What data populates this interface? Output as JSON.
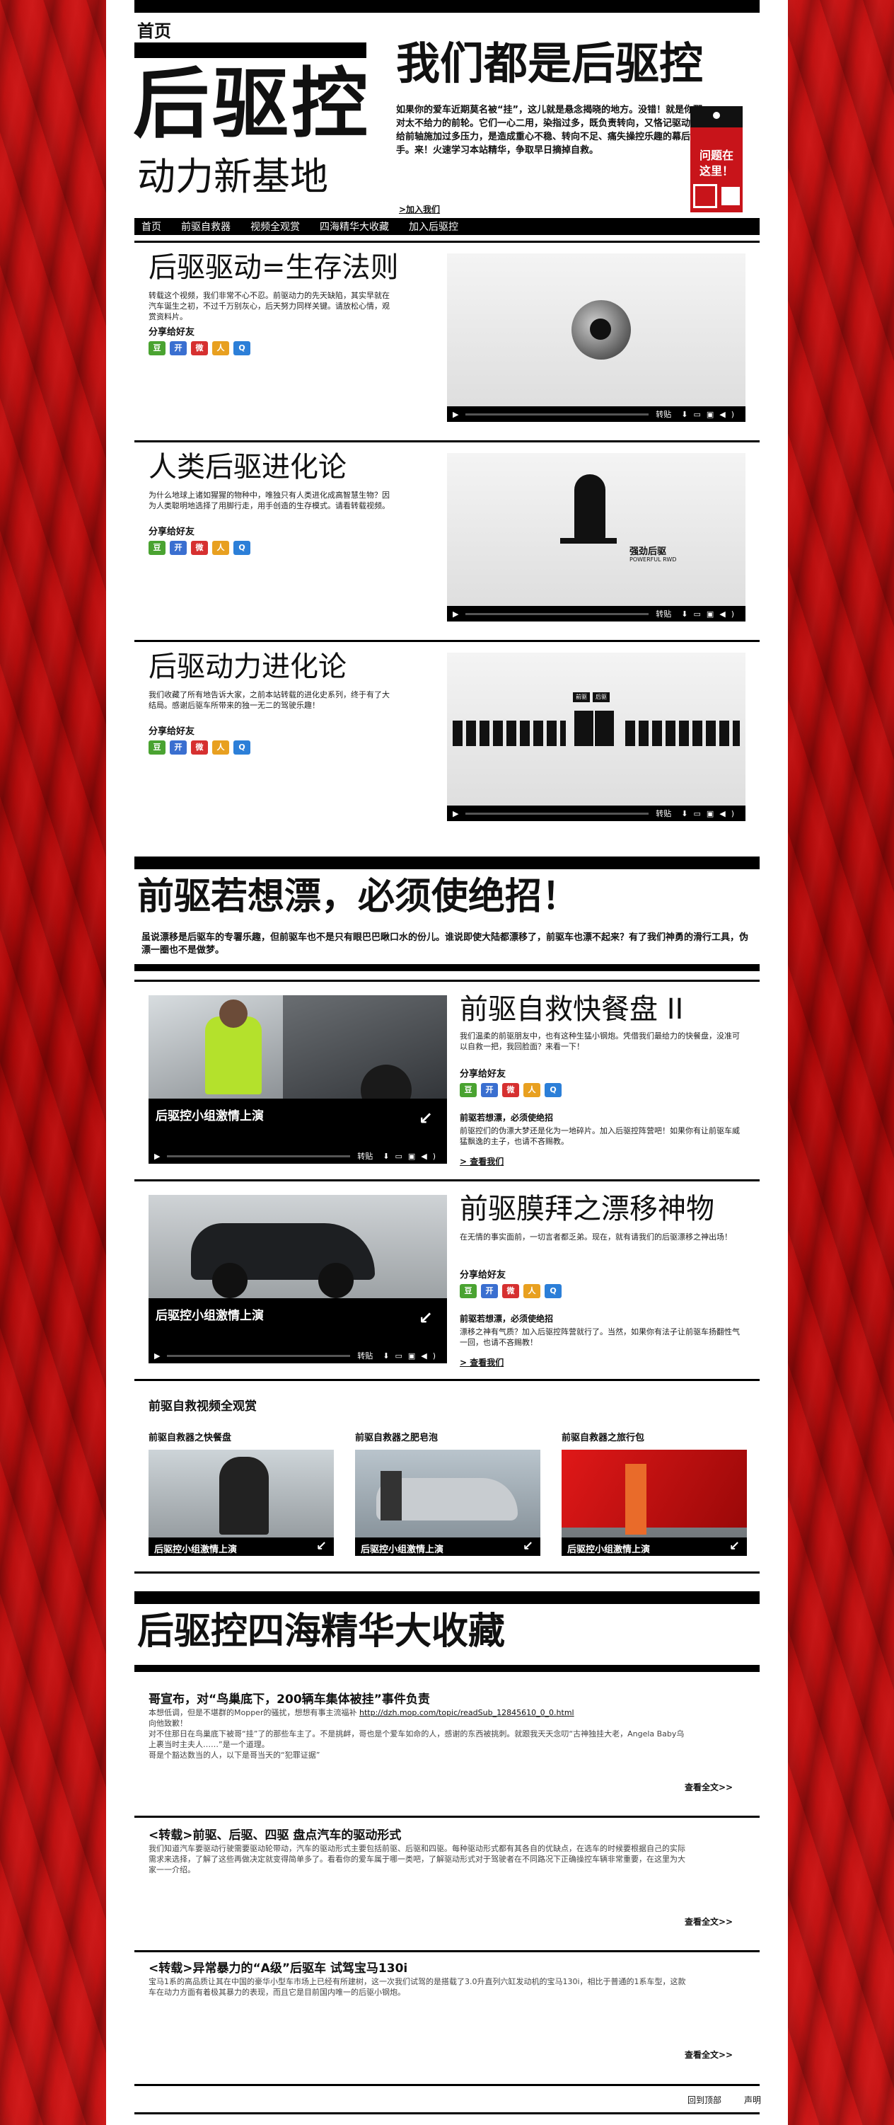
{
  "header": {
    "home": "首页",
    "big_title": "后驱控",
    "sub_title": "动力新基地",
    "slogan": "我们都是后驱控",
    "intro": "如果你的爱车近期莫名被“挂”，这儿就是悬念揭晓的地方。没错！就是你那对太不给力的前轮。它们一心二用，染指过多，既负责转向，又恪记驱动，给前轴施加过多压力，是造成重心不稳、转向不足、痛失操控乐趣的幕后黑手。来！火速学习本站精华，争取早日摘掉自救。",
    "join": ">加入我们",
    "badge_l1": "问题在",
    "badge_l2": "这里！"
  },
  "nav": [
    "首页",
    "前驱自救器",
    "视频全观赏",
    "四海精华大收藏",
    "加入后驱控"
  ],
  "share_label": "分享给好友",
  "share_icons": [
    "douban-icon",
    "kaixin-icon",
    "weibo-icon",
    "renren-icon",
    "qq-icon"
  ],
  "rwd_items": [
    {
      "title": "后驱驱动=生存法则",
      "desc": "转载这个视频，我们非常不心不忍。前驱动力的先天缺陷，其实早就在汽车诞生之初，不过千万别灰心，后天努力同样关键。请放松心情，观赏资料片。"
    },
    {
      "title": "人类后驱进化论",
      "desc": "为什么地球上诸如猩猩的物种中，唯独只有人类进化成高智慧生物？因为人类聪明地选择了用脚行走，用手创造的生存模式。请看转载视频。",
      "video_text": "强劲后驱",
      "video_sub": "POWERFUL RWD"
    },
    {
      "title": "后驱动力进化论",
      "desc": "我们收藏了所有地告诉大家，之前本站转载的进化史系列，终于有了大结局。感谢后驱车所带来的独一无二的驾驶乐趣！",
      "video_tag1": "前驱",
      "video_tag2": "后驱"
    }
  ],
  "video_controls": {
    "repost": "转贴"
  },
  "fwd": {
    "title": "前驱若想漂，必须使绝招！",
    "desc": "虽说漂移是后驱车的专署乐趣，但前驱车也不是只有眼巴巴瞅口水的份儿。谁说即使大陆都漂移了，前驱车也漂不起来？有了我们神勇的滑行工具，伪漂一圈也不是做梦。"
  },
  "fwd_items": [
    {
      "title": "前驱自救快餐盘 II",
      "desc": "我们温柔的前驱朋友中，也有这种生猛小钢炮。凭借我们最给力的快餐盘，没准可以自救一把，我回脸面？来看一下！",
      "overlay": "后驱控小组激情上演",
      "sub_title": "前驱若想漂，必须使绝招",
      "sub_desc": "前驱控们的伪漂大梦还是化为一地碎片。加入后驱控阵营吧！如果你有让前驱车威猛飘逸的主子，也请不吝赐教。",
      "join": "> 查看我们"
    },
    {
      "title": "前驱膜拜之漂移神物",
      "desc": "在无情的事实面前，一切言者都乏弟。现在，就有请我们的后驱漂移之神出场！",
      "overlay": "后驱控小组激情上演",
      "sub_title": "前驱若想漂，必须使绝招",
      "sub_desc": "漂移之神有气质？加入后驱控阵营就行了。当然，如果你有法子让前驱车扬翻性气一回，也请不吝赐教！",
      "join": "> 查看我们"
    }
  ],
  "gallery": {
    "title": "前驱自救视频全观赏",
    "items": [
      {
        "title": "前驱自救器之快餐盘",
        "overlay": "后驱控小组激情上演"
      },
      {
        "title": "前驱自救器之肥皂泡",
        "overlay": "后驱控小组激情上演"
      },
      {
        "title": "前驱自救器之旅行包",
        "overlay": "后驱控小组激情上演"
      }
    ]
  },
  "essence": {
    "title": "后驱控四海精华大收藏",
    "articles": [
      {
        "title": "哥宣布，对“鸟巢底下，200辆车集体被挂”事件负责",
        "body1": "本想低调，但是不堪群的Mopper的骚扰，想想有事主流福补 ",
        "link": "http://dzh.mop.com/topic/readSub_12845610_0_0.html",
        "body2": "向他致歉！\n对不住那日在鸟巢底下被哥“挂”了的那些车主了。不是挑衅，哥也是个爱车如命的人，感谢的东西被挑刺。就跟我天天念叨“古神独挂大老，Angela Baby乌上裹当时主夫人……”是一个道理。\n哥是个豁达数当的人，以下是哥当天的“犯罪证据”",
        "more": "查看全文>>"
      },
      {
        "title": "<转载>前驱、后驱、四驱 盘点汽车的驱动形式",
        "body1": "我们知道汽车要驱动行驶需要驱动轮带动，汽车的驱动形式主要包括前驱、后驱和四驱。每种驱动形式都有其各自的优缺点，在选车的时候要根据自己的实际需求来选择，了解了这些再做决定就变得简单多了。看看你的爱车属于哪一类吧，了解驱动形式对于驾驶者在不同路况下正确操控车辆非常重要，在这里为大家一一介绍。",
        "link": "",
        "body2": "",
        "more": "查看全文>>"
      },
      {
        "title": "<转载>异常暴力的“A级”后驱车 试驾宝马130i",
        "body1": "宝马1系的高品质让其在中国的豪华小型车市场上已经有所建树，这一次我们试驾的是搭载了3.0升直列六缸发动机的宝马130i，相比于普通的1系车型，这款车在动力方面有着极其暴力的表现，而且它是目前国内唯一的后驱小钢炮。",
        "link": "",
        "body2": "",
        "more": "查看全文>>"
      }
    ]
  },
  "footer": {
    "back": "回到顶部",
    "statement": "声明"
  }
}
